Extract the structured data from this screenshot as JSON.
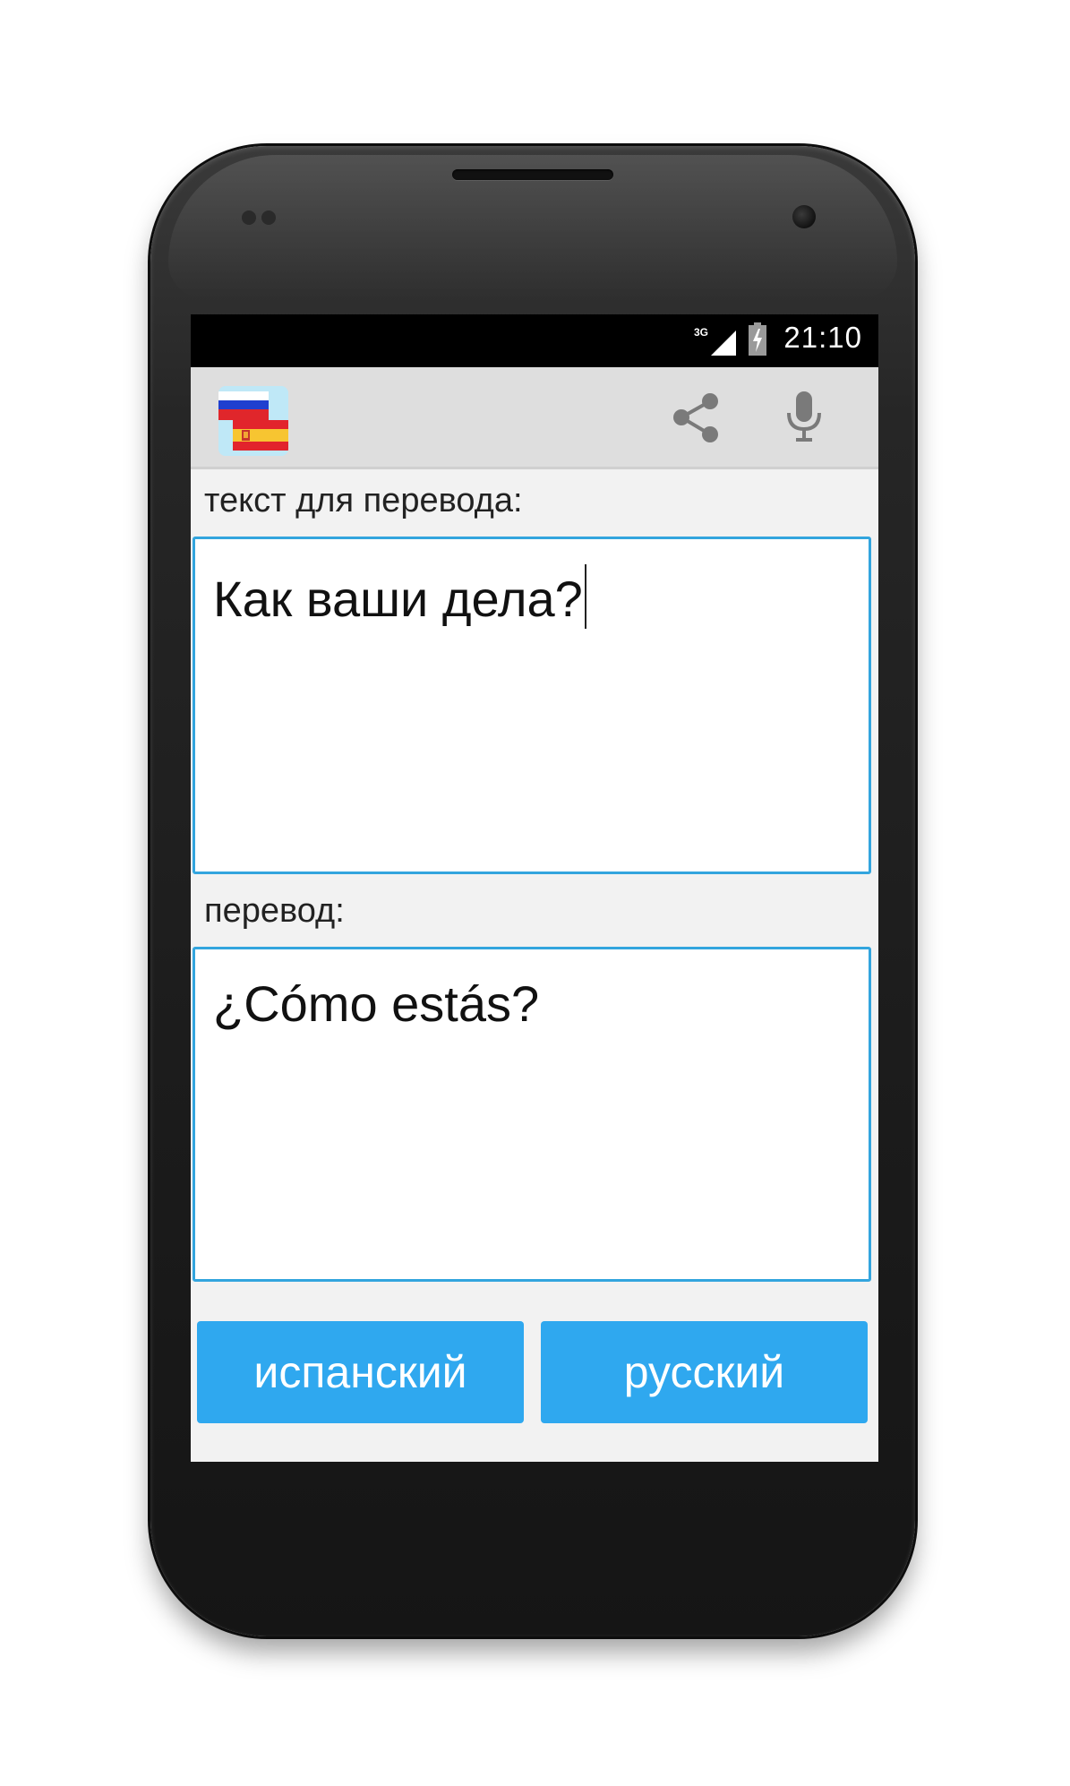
{
  "status_bar": {
    "network": "3G",
    "time": "21:10"
  },
  "action_bar": {
    "app_icon": "russian-spanish-flags-icon",
    "share_icon": "share-icon",
    "mic_icon": "microphone-icon"
  },
  "source": {
    "label": "текст для перевода:",
    "value": "Как ваши дела?"
  },
  "translation": {
    "label": "перевод:",
    "value": "¿Cómo estás?"
  },
  "buttons": {
    "left_label": "испанский",
    "right_label": "русский"
  },
  "colors": {
    "accent": "#33a5de",
    "button": "#2fa8ef",
    "actionbar": "#dedede",
    "background": "#f2f2f2"
  }
}
